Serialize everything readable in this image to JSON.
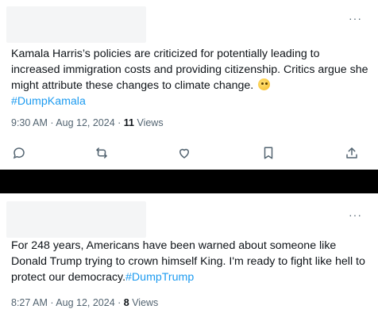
{
  "tweets": [
    {
      "more_label": "···",
      "body_text": "Kamala Harris’s policies are criticized for potentially leading to increased immigration costs and providing citizenship. Critics argue she might attribute these changes to climate change.",
      "emoji": "thinking-face",
      "hashtag": "#DumpKamala",
      "time": "9:30 AM · Aug 12, 2024 · ",
      "views_count": "11",
      "views_label": " Views",
      "actions": [
        "reply-icon",
        "retweet-icon",
        "like-icon",
        "bookmark-icon",
        "share-icon"
      ]
    },
    {
      "more_label": "···",
      "body_text": "For 248 years, Americans have been warned about someone like Donald Trump trying to crown himself King. I'm ready to fight like hell to protect our democracy.",
      "hashtag": "#DumpTrump",
      "time": "8:27 AM · Aug 12, 2024 · ",
      "views_count": "8",
      "views_label": " Views"
    }
  ],
  "colors": {
    "hashtag": "#1d9bf0",
    "meta": "#536471",
    "text": "#0f1419",
    "divider": "#000000",
    "redacted": "#f4f5f6"
  }
}
